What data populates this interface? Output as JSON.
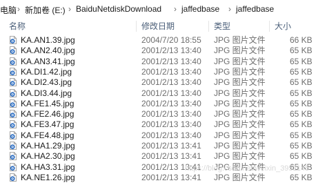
{
  "breadcrumb": {
    "items": [
      "电脑",
      "新加卷 (E:)",
      "BaiduNetdiskDownload",
      "jaffedbase",
      "jaffedbase"
    ]
  },
  "columns": {
    "name": "名称",
    "date": "修改日期",
    "type": "类型",
    "size": "大小"
  },
  "files": [
    {
      "name": "KA.AN1.39.jpg",
      "date": "2004/7/20 18:55",
      "type": "JPG 图片文件",
      "size": "66 KB"
    },
    {
      "name": "KA.AN2.40.jpg",
      "date": "2001/2/13 13:40",
      "type": "JPG 图片文件",
      "size": "65 KB"
    },
    {
      "name": "KA.AN3.41.jpg",
      "date": "2001/2/13 13:40",
      "type": "JPG 图片文件",
      "size": "65 KB"
    },
    {
      "name": "KA.DI1.42.jpg",
      "date": "2001/2/13 13:40",
      "type": "JPG 图片文件",
      "size": "65 KB"
    },
    {
      "name": "KA.DI2.43.jpg",
      "date": "2001/2/13 13:40",
      "type": "JPG 图片文件",
      "size": "65 KB"
    },
    {
      "name": "KA.DI3.44.jpg",
      "date": "2001/2/13 13:40",
      "type": "JPG 图片文件",
      "size": "65 KB"
    },
    {
      "name": "KA.FE1.45.jpg",
      "date": "2001/2/13 13:40",
      "type": "JPG 图片文件",
      "size": "65 KB"
    },
    {
      "name": "KA.FE2.46.jpg",
      "date": "2001/2/13 13:40",
      "type": "JPG 图片文件",
      "size": "65 KB"
    },
    {
      "name": "KA.FE3.47.jpg",
      "date": "2001/2/13 13:40",
      "type": "JPG 图片文件",
      "size": "65 KB"
    },
    {
      "name": "KA.FE4.48.jpg",
      "date": "2001/2/13 13:40",
      "type": "JPG 图片文件",
      "size": "65 KB"
    },
    {
      "name": "KA.HA1.29.jpg",
      "date": "2001/2/13 13:41",
      "type": "JPG 图片文件",
      "size": "65 KB"
    },
    {
      "name": "KA.HA2.30.jpg",
      "date": "2001/2/13 13:41",
      "type": "JPG 图片文件",
      "size": "65 KB"
    },
    {
      "name": "KA.HA3.31.jpg",
      "date": "2001/2/13 13:41",
      "type": "JPG 图片文件",
      "size": "65 KB"
    },
    {
      "name": "KA.NE1.26.jpg",
      "date": "2001/2/13 13:41",
      "type": "JPG 图片文件",
      "size": "65 KB"
    }
  ],
  "watermark": "https://blog.csdn.net/weixin_3951145",
  "colors": {
    "header_text": "#4c607a",
    "meta_text": "#6d6d6d",
    "icon_blue": "#2f6fc2"
  }
}
